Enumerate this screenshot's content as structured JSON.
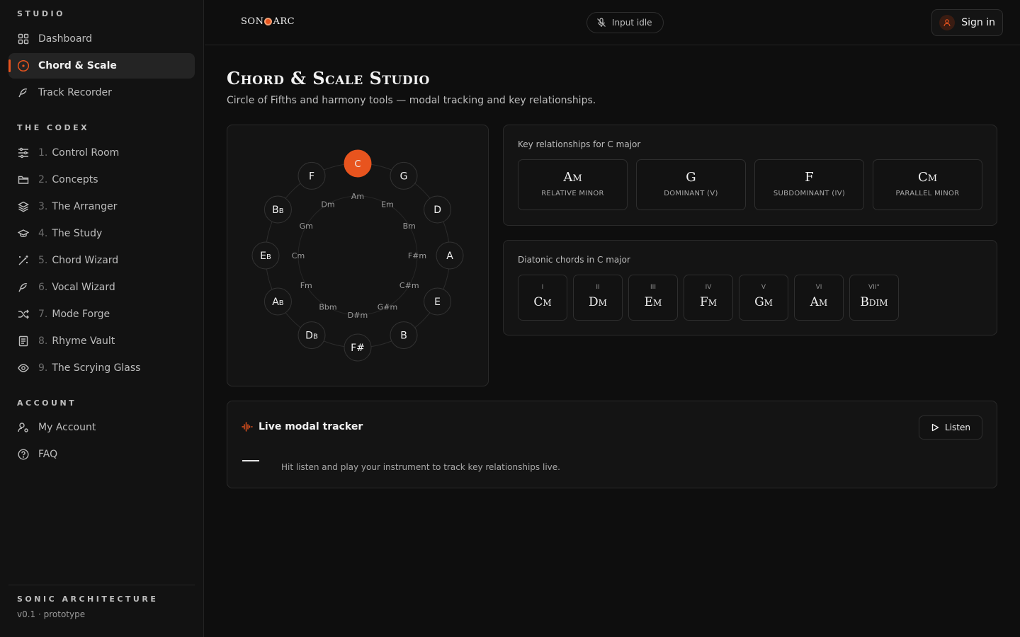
{
  "sidebar": {
    "studio_heading": "STUDIO",
    "studio_items": [
      {
        "label": "Dashboard",
        "icon": "grid-icon"
      },
      {
        "label": "Chord & Scale",
        "icon": "target-icon",
        "active": true
      },
      {
        "label": "Track Recorder",
        "icon": "feather-icon"
      }
    ],
    "codex_heading": "THE CODEX",
    "codex_items": [
      {
        "num": "1.",
        "label": "Control Room",
        "icon": "sliders-icon"
      },
      {
        "num": "2.",
        "label": "Concepts",
        "icon": "folder-icon"
      },
      {
        "num": "3.",
        "label": "The Arranger",
        "icon": "layers-icon"
      },
      {
        "num": "4.",
        "label": "The Study",
        "icon": "graduation-cap-icon"
      },
      {
        "num": "5.",
        "label": "Chord Wizard",
        "icon": "wand-icon"
      },
      {
        "num": "6.",
        "label": "Vocal Wizard",
        "icon": "feather-icon"
      },
      {
        "num": "7.",
        "label": "Mode Forge",
        "icon": "shuffle-icon"
      },
      {
        "num": "8.",
        "label": "Rhyme Vault",
        "icon": "notebook-icon"
      },
      {
        "num": "9.",
        "label": "The Scrying Glass",
        "icon": "eye-icon"
      }
    ],
    "account_heading": "ACCOUNT",
    "account_items": [
      {
        "label": "My Account",
        "icon": "user-cog-icon"
      },
      {
        "label": "FAQ",
        "icon": "help-circle-icon"
      }
    ],
    "footer_title": "SONIC ARCHITECTURE",
    "footer_version": "v0.1 · prototype"
  },
  "header": {
    "logo_left": "SON",
    "logo_right": "ARC",
    "input_status": "Input idle",
    "sign_in": "Sign in"
  },
  "page": {
    "title": "Chord & Scale Studio",
    "subtitle": "Circle of Fifths and harmony tools — modal tracking and key relationships."
  },
  "circle": {
    "selected": "C",
    "majors": [
      "C",
      "G",
      "D",
      "A",
      "E",
      "B",
      "F#",
      "Db",
      "Ab",
      "Eb",
      "Bb",
      "F"
    ],
    "minors": [
      "Am",
      "Em",
      "Bm",
      "F#m",
      "C#m",
      "G#m",
      "D#m",
      "Bbm",
      "Fm",
      "Cm",
      "Gm",
      "Dm"
    ],
    "accent_color": "#e8541e"
  },
  "relationships": {
    "label": "Key relationships for C major",
    "items": [
      {
        "chord": "Am",
        "caption": "RELATIVE MINOR"
      },
      {
        "chord": "G",
        "caption": "DOMINANT (V)"
      },
      {
        "chord": "F",
        "caption": "SUBDOMINANT (IV)"
      },
      {
        "chord": "Cm",
        "caption": "PARALLEL MINOR"
      }
    ]
  },
  "diatonic": {
    "label": "Diatonic chords in C major",
    "items": [
      {
        "numeral": "I",
        "chord": "Cm"
      },
      {
        "numeral": "II",
        "chord": "Dm"
      },
      {
        "numeral": "III",
        "chord": "Em"
      },
      {
        "numeral": "IV",
        "chord": "Fm"
      },
      {
        "numeral": "V",
        "chord": "Gm"
      },
      {
        "numeral": "VI",
        "chord": "Am"
      },
      {
        "numeral": "VII°",
        "chord": "Bdim"
      }
    ]
  },
  "tracker": {
    "title": "Live modal tracker",
    "listen": "Listen",
    "reading": "—",
    "message": "Hit listen and play your instrument to track key relationships live."
  }
}
